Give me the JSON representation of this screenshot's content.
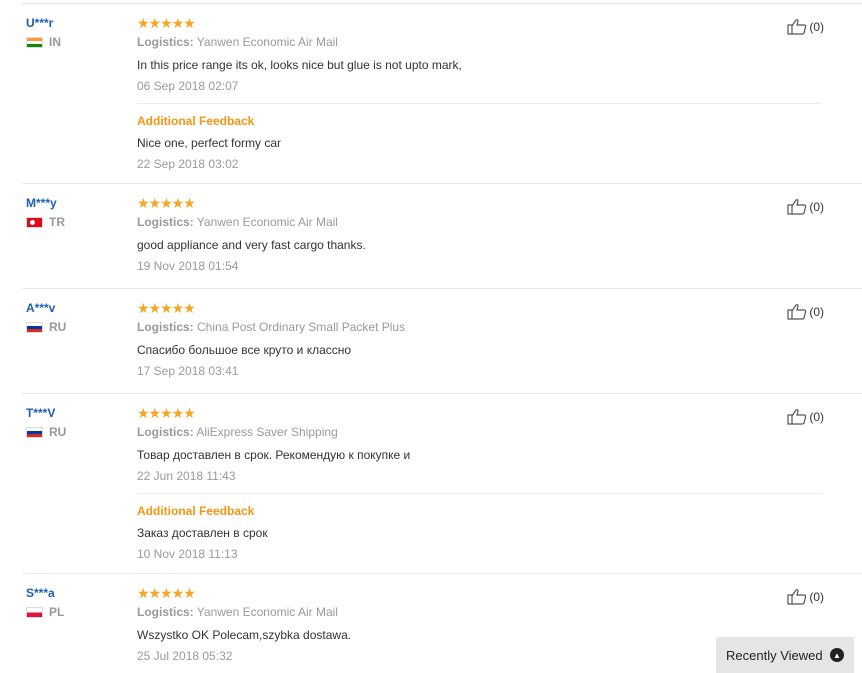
{
  "reviews": [
    {
      "user": "U***r",
      "country": "IN",
      "flag": "in",
      "stars": "★★★★★",
      "logistics_label": "Logistics:",
      "logistics": "Yanwen Economic Air Mail",
      "text": "In this price range its ok, looks nice but glue is not upto mark,",
      "date": "06 Sep 2018 02:07",
      "additional_title": "Additional Feedback",
      "additional_text": "Nice one, perfect formy car",
      "additional_date": "22 Sep 2018 03:02",
      "helpful": "(0)"
    },
    {
      "user": "M***y",
      "country": "TR",
      "flag": "tr",
      "stars": "★★★★★",
      "logistics_label": "Logistics:",
      "logistics": "Yanwen Economic Air Mail",
      "text": "good appliance and very fast cargo thanks.",
      "date": "19 Nov 2018 01:54",
      "helpful": "(0)"
    },
    {
      "user": "A***v",
      "country": "RU",
      "flag": "ru",
      "stars": "★★★★★",
      "logistics_label": "Logistics:",
      "logistics": "China Post Ordinary Small Packet Plus",
      "text": "Спасибо большое все круто и классно",
      "date": "17 Sep 2018 03:41",
      "helpful": "(0)"
    },
    {
      "user": "T***V",
      "country": "RU",
      "flag": "ru",
      "stars": "★★★★★",
      "logistics_label": "Logistics:",
      "logistics": "AliExpress Saver Shipping",
      "text": "Товар доставлен в срок. Рекомендую к покупке и",
      "date": "22 Jun 2018 11:43",
      "additional_title": "Additional Feedback",
      "additional_text": "Заказ доставлен в срок",
      "additional_date": "10 Nov 2018 11:13",
      "helpful": "(0)"
    },
    {
      "user": "S***a",
      "country": "PL",
      "flag": "pl",
      "stars": "★★★★★",
      "logistics_label": "Logistics:",
      "logistics": "Yanwen Economic Air Mail",
      "text": "Wszystko OK Polecam,szybka dostawa.",
      "date": "25 Jul 2018 05:32",
      "helpful": "(0)"
    }
  ],
  "recently_viewed": {
    "label": "Recently Viewed",
    "icon": "chevron-up-icon"
  },
  "colors": {
    "stars": "#f5a623",
    "additional": "#f59512",
    "username": "#1a5fb4"
  }
}
